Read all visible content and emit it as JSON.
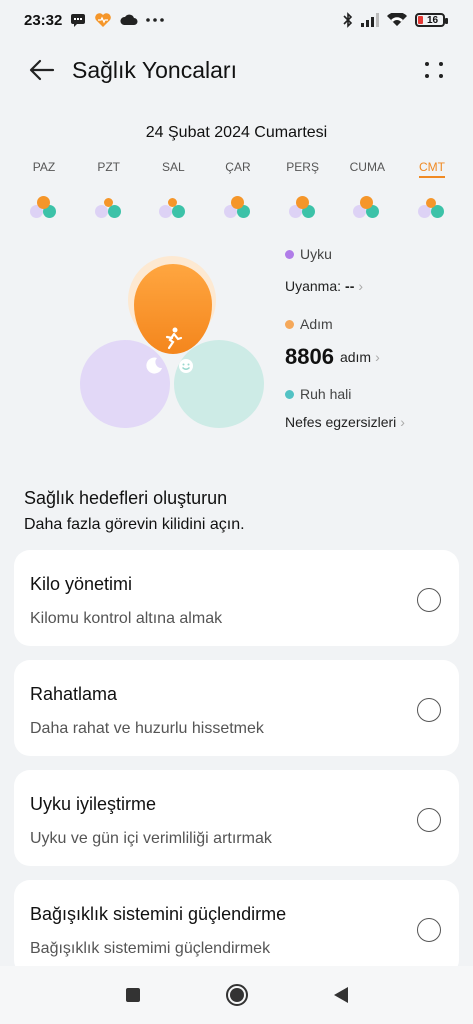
{
  "status_bar": {
    "time": "23:32",
    "left_icons": [
      "message-icon",
      "health-app-icon",
      "cloud-icon",
      "more-notifications-icon"
    ],
    "right_icons": [
      "bluetooth-icon",
      "signal-icon",
      "wifi-icon"
    ],
    "battery_level": "16",
    "battery_color": "#e53935"
  },
  "header": {
    "title": "Sağlık Yoncaları",
    "back_icon": "arrow-left-icon",
    "menu_icon": "more-grid-icon"
  },
  "date": "24 Şubat 2024 Cumartesi",
  "week": [
    {
      "label": "PAZ",
      "active": false
    },
    {
      "label": "PZT",
      "active": false
    },
    {
      "label": "SAL",
      "active": false
    },
    {
      "label": "ÇAR",
      "active": false
    },
    {
      "label": "PERŞ",
      "active": false
    },
    {
      "label": "CUMA",
      "active": false
    },
    {
      "label": "CMT",
      "active": true
    }
  ],
  "colors": {
    "accent": "#f08a24",
    "sleep": "#b07ce8",
    "steps": "#f5a85a",
    "mood": "#52c2c4"
  },
  "legend": {
    "sleep": {
      "label": "Uyku",
      "sub_label": "Uyanma:",
      "value": "--"
    },
    "steps": {
      "label": "Adım",
      "value": "8806",
      "unit": "adım"
    },
    "mood": {
      "label": "Ruh hali",
      "sub_label": "Nefes egzersizleri"
    }
  },
  "goals": {
    "title": "Sağlık hedefleri oluşturun",
    "subtitle": "Daha fazla görevin kilidini açın.",
    "items": [
      {
        "title": "Kilo yönetimi",
        "subtitle": "Kilomu kontrol altına almak"
      },
      {
        "title": "Rahatlama",
        "subtitle": "Daha rahat ve huzurlu hissetmek"
      },
      {
        "title": "Uyku iyileştirme",
        "subtitle": "Uyku ve gün içi verimliliği artırmak"
      },
      {
        "title": "Bağışıklık sistemini güçlendirme",
        "subtitle": "Bağışıklık sistemimi güçlendirmek"
      }
    ]
  },
  "nav_bar": [
    "recents-square-icon",
    "home-circle-icon",
    "back-triangle-icon"
  ]
}
